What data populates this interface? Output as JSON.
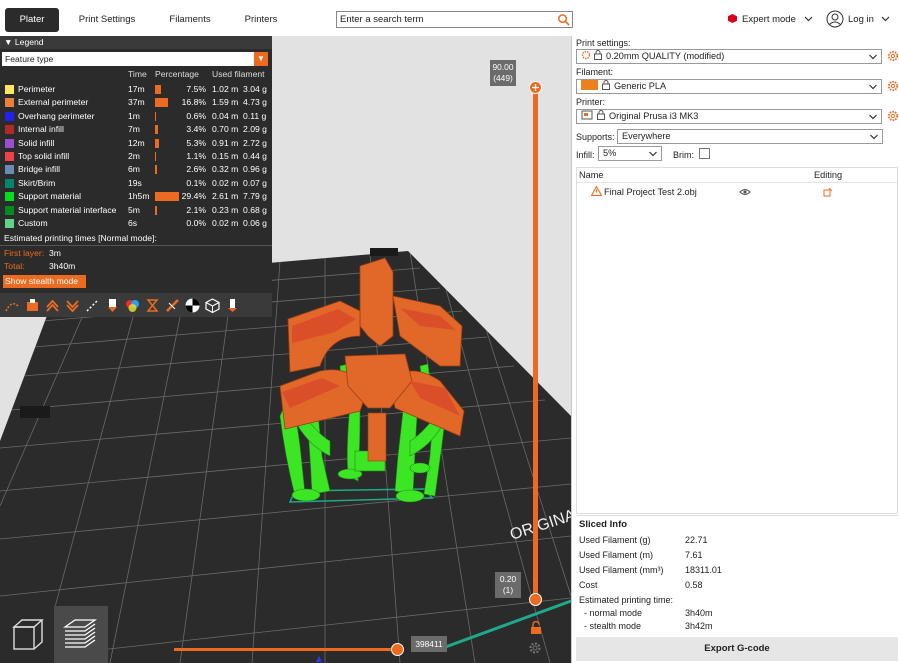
{
  "tabs": [
    {
      "label": "Plater",
      "active": true
    },
    {
      "label": "Print Settings",
      "active": false
    },
    {
      "label": "Filaments",
      "active": false
    },
    {
      "label": "Printers",
      "active": false
    }
  ],
  "search": {
    "placeholder": "Enter a search term"
  },
  "mode": {
    "label": "Expert mode",
    "color": "#d9001a"
  },
  "login": {
    "label": "Log in"
  },
  "legend": {
    "title": "Legend",
    "feature_type": "Feature type",
    "headers": {
      "time": "Time",
      "percentage": "Percentage",
      "used": "Used filament"
    },
    "rows": [
      {
        "name": "Perimeter",
        "color": "#ffe65c",
        "time": "17m",
        "pct": "7.5%",
        "pct_value": 7.5,
        "used": "1.02 m  3.04 g"
      },
      {
        "name": "External perimeter",
        "color": "#ed7f3a",
        "time": "37m",
        "pct": "16.8%",
        "pct_value": 16.8,
        "used": "1.59 m  4.73 g"
      },
      {
        "name": "Overhang perimeter",
        "color": "#2420ee",
        "time": "1m",
        "pct": "0.6%",
        "pct_value": 0.6,
        "used": "0.04 m  0.11 g"
      },
      {
        "name": "Internal infill",
        "color": "#b02a2a",
        "time": "7m",
        "pct": "3.4%",
        "pct_value": 3.4,
        "used": "0.70 m  2.09 g"
      },
      {
        "name": "Solid infill",
        "color": "#9b4fcf",
        "time": "12m",
        "pct": "5.3%",
        "pct_value": 5.3,
        "used": "0.91 m  2.72 g"
      },
      {
        "name": "Top solid infill",
        "color": "#f0404a",
        "time": "2m",
        "pct": "1.1%",
        "pct_value": 1.1,
        "used": "0.15 m  0.44 g"
      },
      {
        "name": "Bridge infill",
        "color": "#6a8bb3",
        "time": "6m",
        "pct": "2.6%",
        "pct_value": 2.6,
        "used": "0.32 m  0.96 g"
      },
      {
        "name": "Skirt/Brim",
        "color": "#00856f",
        "time": "19s",
        "pct": "0.1%",
        "pct_value": 0.1,
        "used": "0.02 m  0.07 g"
      },
      {
        "name": "Support material",
        "color": "#00e022",
        "time": "1h5m",
        "pct": "29.4%",
        "pct_value": 29.4,
        "used": "2.61 m  7.79 g"
      },
      {
        "name": "Support material interface",
        "color": "#008c20",
        "time": "5m",
        "pct": "2.1%",
        "pct_value": 2.1,
        "used": "0.23 m  0.68 g"
      },
      {
        "name": "Custom",
        "color": "#5fd38a",
        "time": "6s",
        "pct": "0.0%",
        "pct_value": 0.0,
        "used": "0.02 m  0.06 g"
      }
    ],
    "estimated": "Estimated printing times [Normal mode]:",
    "first_layer_label": "First layer:",
    "first_layer_value": "3m",
    "total_label": "Total:",
    "total_value": "3h40m",
    "stealth_button": "Show stealth mode"
  },
  "slider": {
    "top_value": "90.00",
    "top_layer": "(449)",
    "bottom_value": "0.20",
    "bottom_layer": "(1)",
    "horizontal_value": "398411"
  },
  "settings": {
    "print_label": "Print settings:",
    "print_value": "0.20mm QUALITY (modified)",
    "filament_label": "Filament:",
    "filament_value": "Generic PLA",
    "filament_color": "#ed7f1e",
    "printer_label": "Printer:",
    "printer_value": "Original Prusa i3 MK3",
    "supports_label": "Supports:",
    "supports_value": "Everywhere",
    "infill_label": "Infill:",
    "infill_value": "5%",
    "brim_label": "Brim:"
  },
  "objects": {
    "col_name": "Name",
    "col_editing": "Editing",
    "items": [
      {
        "name": "Final Project Test 2.obj"
      }
    ]
  },
  "sliced": {
    "title": "Sliced Info",
    "rows": [
      {
        "label": "Used Filament (g)",
        "value": "22.71"
      },
      {
        "label": "Used Filament (m)",
        "value": "7.61"
      },
      {
        "label": "Used Filament (mm³)",
        "value": "18311.01"
      },
      {
        "label": "Cost",
        "value": "0.58"
      },
      {
        "label": "Estimated printing time:",
        "value": ""
      },
      {
        "label": "  - normal mode",
        "value": "3h40m"
      },
      {
        "label": "  - stealth mode",
        "value": "3h42m"
      }
    ]
  },
  "export_button": "Export G-code",
  "bed_text": "ORIGINAL",
  "colors": {
    "accent": "#ed6b21",
    "support": "#3de625",
    "model": "#e2682a"
  }
}
